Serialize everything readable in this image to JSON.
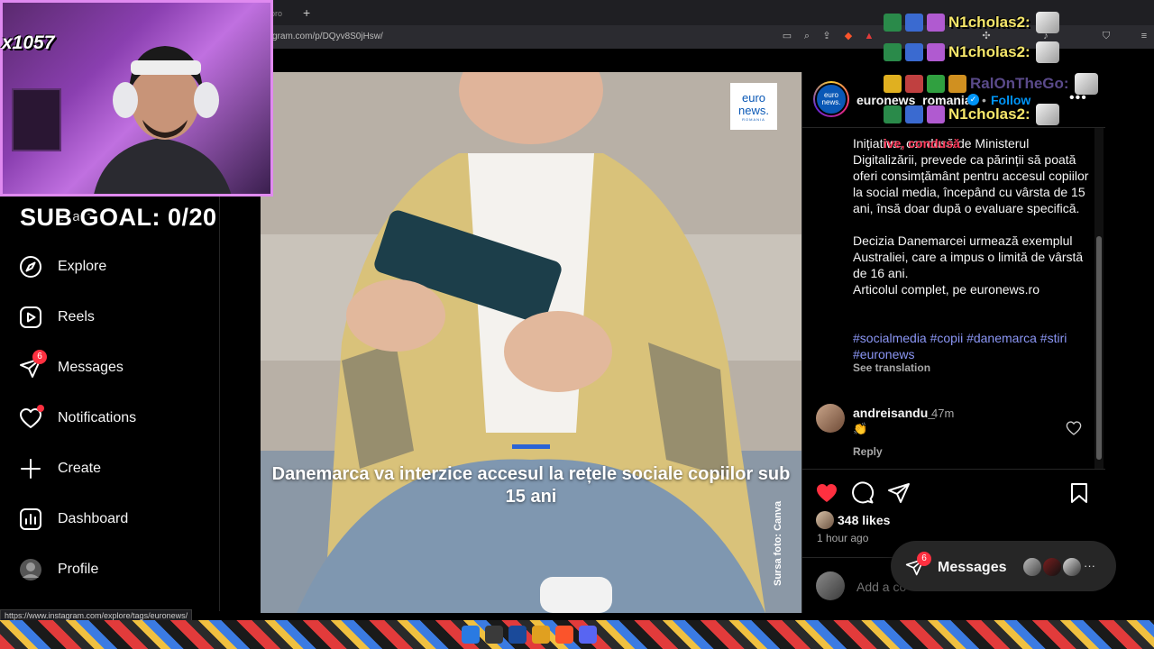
{
  "browser": {
    "tab_label": "pro",
    "new_tab": "+",
    "url": "gram.com/p/DQyv8S0jHsw/"
  },
  "stream": {
    "cam_counter": "x1057",
    "sub_goal": "SUB GOAL: 0/20",
    "chat": [
      {
        "user": "N1cholas2:",
        "color": "#f5e66a"
      },
      {
        "user": "N1cholas2:",
        "color": "#f5e66a"
      },
      {
        "user": "RalOnTheGo:",
        "color": "#5a4a8a"
      },
      {
        "user": "N1cholas2:",
        "color": "#f5e66a"
      }
    ],
    "chat_fragment": "ive, condusă"
  },
  "sidebar": {
    "search_label": "Search",
    "items": [
      {
        "label": "Explore",
        "icon": "compass-icon"
      },
      {
        "label": "Reels",
        "icon": "reels-icon"
      },
      {
        "label": "Messages",
        "icon": "messages-icon",
        "badge": "6"
      },
      {
        "label": "Notifications",
        "icon": "heart-icon",
        "dot": true
      },
      {
        "label": "Create",
        "icon": "plus-icon"
      },
      {
        "label": "Dashboard",
        "icon": "dashboard-icon"
      },
      {
        "label": "Profile",
        "icon": "profile-avatar"
      }
    ]
  },
  "post": {
    "logo_main": "euro news.",
    "logo_sub": "ROMANIA",
    "headline": "Danemarca va interzice accesul la rețele sociale copiilor sub 15 ani",
    "credit": "Sursa foto: Canva"
  },
  "panel": {
    "account": "euronews_romania",
    "account_avatar_text": "euro news.",
    "dot_sep": "•",
    "follow": "Follow",
    "more": "•••",
    "caption": [
      "Inițiativa, condusă de Ministerul Digitalizării, prevede ca părinții să poată oferi consimțământ pentru accesul copiilor la social media, începând cu vârsta de 15 ani, însă doar după o evaluare specifică.",
      "Decizia Danemarcei urmează exemplul Australiei, care a impus o limită de vârstă de 16 ani.",
      "Articolul complet, pe euronews.ro"
    ],
    "hashtags": "#socialmedia #copii #danemarca #stiri #euronews",
    "see_translation": "See translation",
    "comment": {
      "user": "andreisandu_",
      "time": "47m",
      "text": "👏",
      "reply": "Reply"
    },
    "likes": "348 likes",
    "post_time": "1 hour ago",
    "add_comment_placeholder": "Add a co"
  },
  "messages_pill": {
    "label": "Messages",
    "badge": "6",
    "more": "···"
  },
  "status_bar_url": "https://www.instagram.com/explore/tags/euronews/",
  "colors": {
    "like_red": "#ff3040",
    "link_blue": "#0095f6",
    "hashtag": "#8b96f5"
  }
}
